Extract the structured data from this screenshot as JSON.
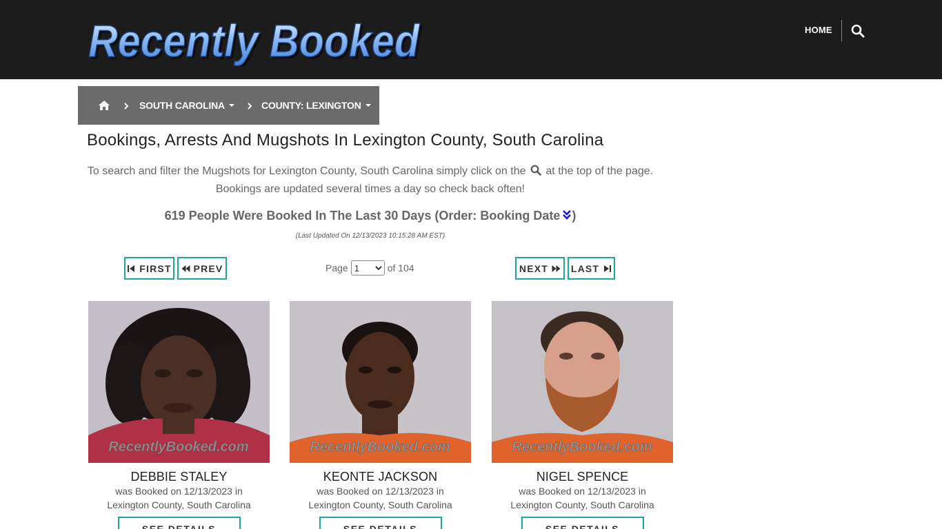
{
  "header": {
    "logo_text": "Recently Booked",
    "nav_home": "HOME",
    "search_icon": "search-icon"
  },
  "breadcrumb": {
    "home_icon": "home-icon",
    "state": "SOUTH CAROLINA",
    "county": "COUNTY: LEXINGTON"
  },
  "main": {
    "title": "Bookings, Arrests And Mugshots In Lexington County, South Carolina",
    "intro_before": "To search and filter the Mugshots for Lexington County, South Carolina simply click on the",
    "intro_after": "at the top of the page. Bookings are updated several times a day so check back often!",
    "count_text": "619 People Were Booked In The Last 30 Days (Order: Booking Date",
    "count_close": ")",
    "last_updated": "(Last Updated On 12/13/2023 10:15:28 AM EST)"
  },
  "pagination": {
    "first": "FIRST",
    "prev": "PREV",
    "next": "NEXT",
    "last": "LAST",
    "page_label": "Page",
    "current_page": "1",
    "of_label": "of 104"
  },
  "bookings": [
    {
      "name": "DEBBIE STALEY",
      "line1": "was Booked on 12/13/2023 in",
      "line2": "Lexington County, South Carolina",
      "watermark": "RecentlyBooked.com",
      "button": "SEE DETAILS"
    },
    {
      "name": "KEONTE JACKSON",
      "line1": "was Booked on 12/13/2023 in",
      "line2": "Lexington County, South Carolina",
      "watermark": "RecentlyBooked.com",
      "button": "SEE DETAILS"
    },
    {
      "name": "NIGEL SPENCE",
      "line1": "was Booked on 12/13/2023 in",
      "line2": "Lexington County, South Carolina",
      "watermark": "RecentlyBooked.com",
      "button": "SEE DETAILS"
    }
  ],
  "colors": {
    "header_bg": "#1c1c1c",
    "breadcrumb_bg": "#6b6b6b",
    "accent_teal": "#1aa79b",
    "order_icon_blue": "#1a1acc"
  }
}
